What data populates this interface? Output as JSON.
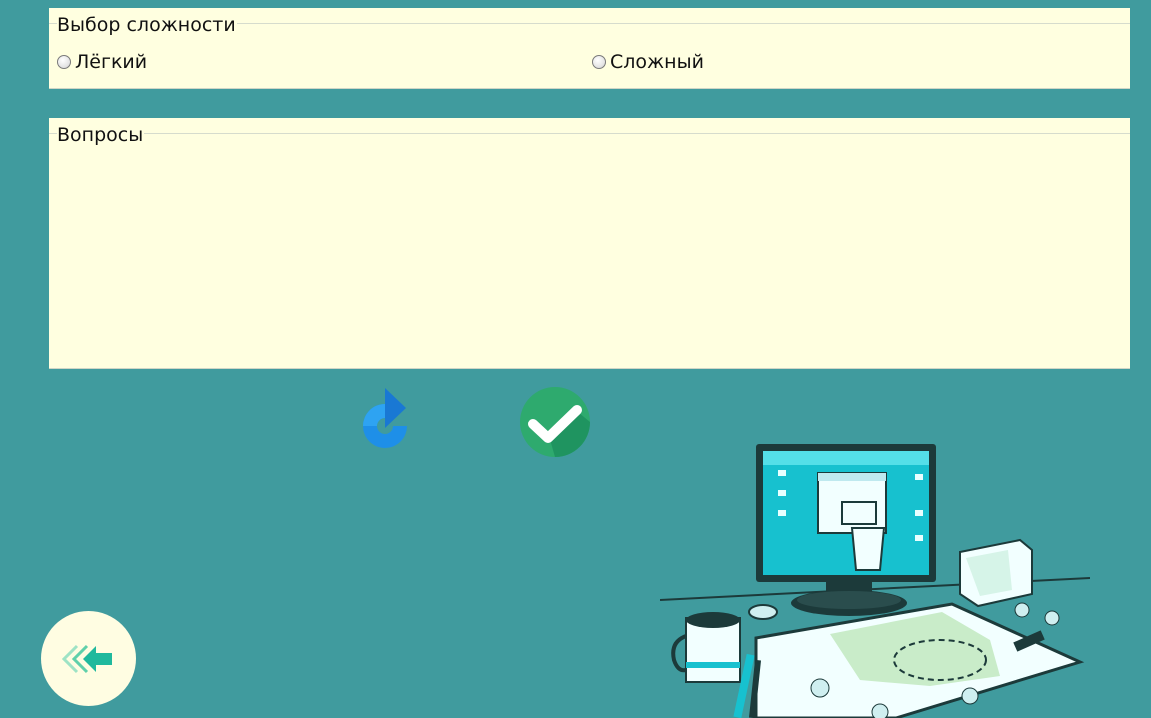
{
  "difficulty": {
    "legend": "Выбор сложности",
    "options": [
      {
        "label": "Лёгкий",
        "checked": false
      },
      {
        "label": "Сложный",
        "checked": false
      }
    ]
  },
  "questions": {
    "legend": "Вопросы"
  },
  "icons": {
    "reset": "refresh-icon",
    "check": "checkmark-icon",
    "back": "double-arrow-left-icon",
    "illustration": "computer-desk-illustration"
  },
  "colors": {
    "background": "#409b9e",
    "panel": "#ffffe0",
    "reset_blue": "#1e8fe8",
    "check_green": "#2eaa6e",
    "back_circle": "#fffde2"
  }
}
